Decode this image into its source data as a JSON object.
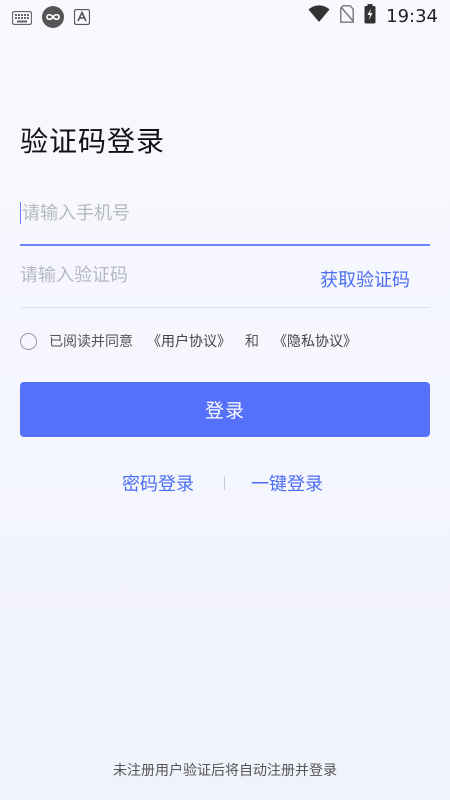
{
  "status_bar": {
    "time": "19:34",
    "icons": [
      "keyboard-icon",
      "infinity-icon",
      "font-a-icon",
      "wifi-icon",
      "no-sim-icon",
      "battery-charging-icon"
    ]
  },
  "page": {
    "title": "验证码登录"
  },
  "phone": {
    "placeholder": "请输入手机号",
    "value": ""
  },
  "code": {
    "placeholder": "请输入验证码",
    "value": "",
    "get_code_label": "获取验证码"
  },
  "agreement": {
    "checked": false,
    "prefix": "已阅读并同意",
    "user_agreement": "《用户协议》",
    "and": "和",
    "privacy_agreement": "《隐私协议》"
  },
  "login": {
    "button_label": "登录"
  },
  "alt_login": {
    "password_login": "密码登录",
    "one_key_login": "一键登录"
  },
  "footer": {
    "note": "未注册用户验证后将自动注册并登录"
  },
  "colors": {
    "accent": "#5571fa",
    "link": "#4c6ef5",
    "focus_underline": "#6b86f6",
    "background_top": "#f8f9ff",
    "background_bottom": "#f1f3fc"
  }
}
